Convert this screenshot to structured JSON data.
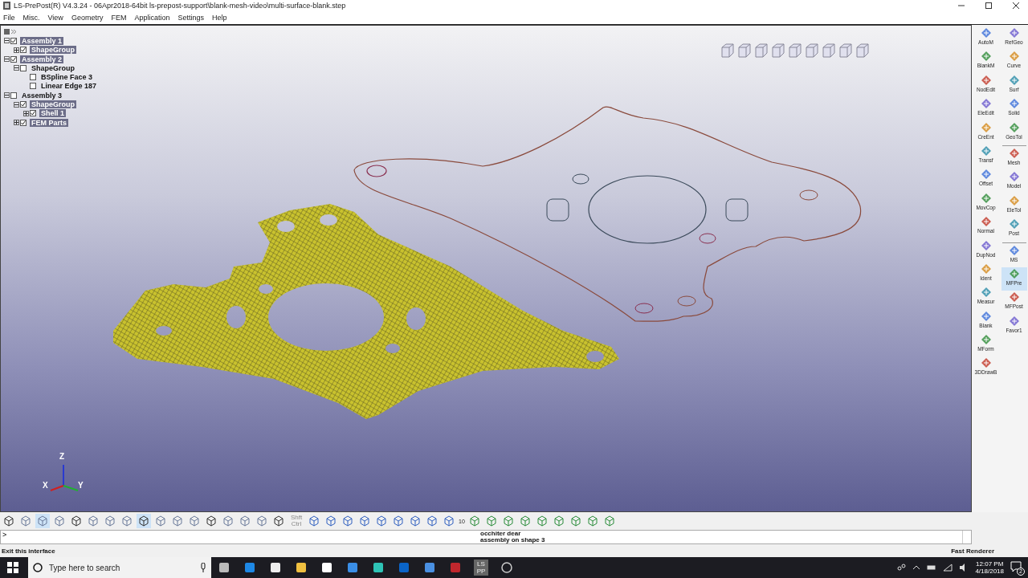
{
  "window": {
    "title": "LS-PrePost(R) V4.3.24 - 06Apr2018-64bit ls-prepost-support\\blank-mesh-video\\multi-surface-blank.step"
  },
  "menu": [
    "File",
    "Misc.",
    "View",
    "Geometry",
    "FEM",
    "Application",
    "Settings",
    "Help"
  ],
  "tree": [
    {
      "label": "Assembly 1",
      "checked": true,
      "expanded": true,
      "children": [
        {
          "label": "ShapeGroup",
          "checked": true,
          "expanded": false
        }
      ]
    },
    {
      "label": "Assembly 2",
      "checked": true,
      "expanded": true,
      "children": [
        {
          "label": "ShapeGroup",
          "checked": false,
          "expanded": true,
          "children": [
            {
              "label": "BSpline Face 3",
              "checked": false
            },
            {
              "label": "Linear Edge 187",
              "checked": false
            }
          ]
        }
      ]
    },
    {
      "label": "Assembly 3",
      "checked": false,
      "expanded": true,
      "children": [
        {
          "label": "ShapeGroup",
          "checked": true,
          "expanded": true,
          "children": [
            {
              "label": "Shell 1",
              "checked": true,
              "expanded": false
            }
          ]
        },
        {
          "label": "FEM Parts",
          "checked": true,
          "expanded": false
        }
      ]
    }
  ],
  "axes": {
    "z": "Z",
    "x": "X",
    "y": "Y"
  },
  "right_panel": {
    "left_column": [
      {
        "label": "AutoM",
        "selected": false
      },
      {
        "label": "BlankM",
        "selected": false
      },
      {
        "label": "NodEdit",
        "selected": false
      },
      {
        "label": "EleEdit",
        "selected": false
      },
      {
        "label": "CreEnt",
        "selected": false
      },
      {
        "label": "Transf",
        "selected": false
      },
      {
        "label": "Offset",
        "selected": false
      },
      {
        "label": "MovCop",
        "selected": false
      },
      {
        "label": "Normal",
        "selected": false
      },
      {
        "label": "DupNod",
        "selected": false
      },
      {
        "label": "Ident",
        "selected": false
      },
      {
        "label": "Measur",
        "selected": false
      },
      {
        "label": "Blank",
        "selected": false
      },
      {
        "label": "MForm",
        "selected": false
      },
      {
        "label": "3DDrawB",
        "selected": false
      }
    ],
    "right_column": [
      {
        "label": "RefGeo",
        "selected": false
      },
      {
        "label": "Curve",
        "selected": false
      },
      {
        "label": "Surf",
        "selected": false
      },
      {
        "label": "Solid",
        "selected": false
      },
      {
        "label": "GeoTol",
        "selected": false
      },
      {
        "label": "Mesh",
        "selected": false
      },
      {
        "label": "Model",
        "selected": false
      },
      {
        "label": "EleTol",
        "selected": false
      },
      {
        "label": "Post",
        "selected": false
      },
      {
        "label": "MS",
        "selected": false
      },
      {
        "label": "MFPre",
        "selected": true
      },
      {
        "label": "MFPost",
        "selected": false
      },
      {
        "label": "Favor1",
        "selected": false
      }
    ]
  },
  "toolbar": {
    "modifier_label": "Shft Ctrl",
    "step_label": "10"
  },
  "command": {
    "prompt": ">",
    "output": [
      "occhiter dear",
      "assembly on shape 3"
    ]
  },
  "status_bar": {
    "message": "Exit this interface",
    "renderer": "Fast Renderer"
  },
  "taskbar": {
    "search_placeholder": "Type here to search",
    "app_label": "LS PP",
    "time": "12:07 PM",
    "date": "4/18/2018",
    "notifications": "2"
  }
}
